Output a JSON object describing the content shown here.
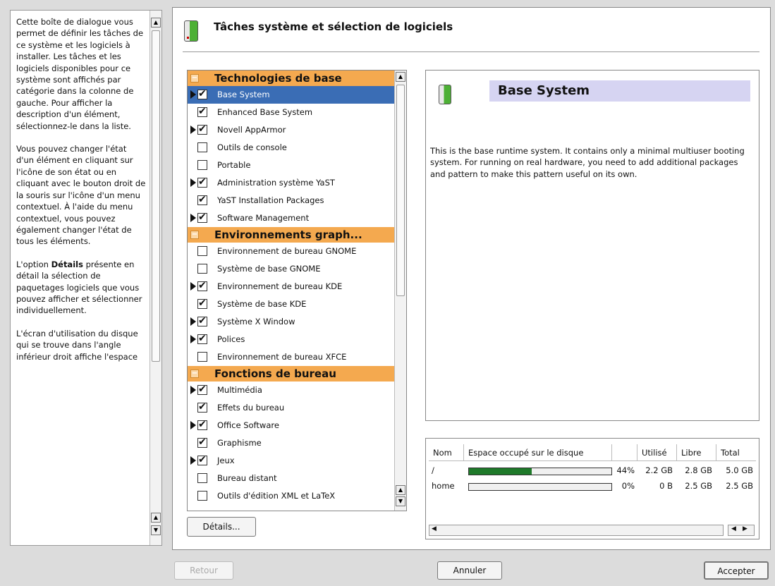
{
  "help": {
    "paragraphs": [
      "Cette boîte de dialogue vous permet de définir les tâches de ce système et les logiciels à installer. Les tâches et les logiciels disponibles pour ce système sont affichés par catégorie dans la colonne de gauche. Pour afficher la description d'un élément, sélectionnez-le dans la liste.",
      "Vous pouvez changer l'état d'un élément en cliquant sur l'icône de son état ou en cliquant avec le bouton droit de la souris sur l'icône d'un menu contextuel. À l'aide du menu contextuel, vous pouvez également changer l'état de tous les éléments."
    ],
    "details_prefix": "L'option ",
    "details_bold": "Détails",
    "details_suffix": " présente en détail la sélection de paquetages logiciels que vous pouvez afficher et sélectionner individuellement.",
    "last_paragraph": "L'écran d'utilisation du disque qui se trouve dans l'angle inférieur droit affiche l'espace"
  },
  "title": "Tâches système et sélection de logiciels",
  "patterns": {
    "categories": [
      {
        "label": "Technologies de base",
        "items": [
          {
            "label": "Base System",
            "checked": true,
            "arrow": true,
            "selected": true
          },
          {
            "label": "Enhanced Base System",
            "checked": true,
            "arrow": false
          },
          {
            "label": "Novell AppArmor",
            "checked": true,
            "arrow": true
          },
          {
            "label": "Outils de console",
            "checked": false,
            "arrow": false
          },
          {
            "label": "Portable",
            "checked": false,
            "arrow": false
          },
          {
            "label": "Administration système YaST",
            "checked": true,
            "arrow": true
          },
          {
            "label": "YaST Installation Packages",
            "checked": true,
            "arrow": false
          },
          {
            "label": "Software Management",
            "checked": true,
            "arrow": true
          }
        ]
      },
      {
        "label": "Environnements graph...",
        "items": [
          {
            "label": "Environnement de bureau GNOME",
            "checked": false,
            "arrow": false
          },
          {
            "label": "Système de base GNOME",
            "checked": false,
            "arrow": false
          },
          {
            "label": "Environnement de bureau KDE",
            "checked": true,
            "arrow": true
          },
          {
            "label": "Système de base KDE",
            "checked": true,
            "arrow": false
          },
          {
            "label": "Système X Window",
            "checked": true,
            "arrow": true
          },
          {
            "label": "Polices",
            "checked": true,
            "arrow": true
          },
          {
            "label": "Environnement de bureau XFCE",
            "checked": false,
            "arrow": false
          }
        ]
      },
      {
        "label": "Fonctions de bureau",
        "items": [
          {
            "label": "Multimédia",
            "checked": true,
            "arrow": true
          },
          {
            "label": "Effets du bureau",
            "checked": true,
            "arrow": false
          },
          {
            "label": "Office Software",
            "checked": true,
            "arrow": true
          },
          {
            "label": "Graphisme",
            "checked": true,
            "arrow": false
          },
          {
            "label": "Jeux",
            "checked": true,
            "arrow": true
          },
          {
            "label": "Bureau distant",
            "checked": false,
            "arrow": false
          },
          {
            "label": "Outils d'édition XML et LaTeX",
            "checked": false,
            "arrow": false
          }
        ]
      }
    ]
  },
  "details_button": "Détails...",
  "description": {
    "title": "Base System",
    "text": "This is the base runtime system. It contains only a minimal multiuser booting system. For running on real hardware, you need to add additional packages and pattern to make this pattern useful on its own."
  },
  "disk": {
    "headers": [
      "Nom",
      "Espace occupé sur le disque",
      "Utilisé",
      "Libre",
      "Total"
    ],
    "rows": [
      {
        "name": "/",
        "percent_label": "44%",
        "fraction": 0.44,
        "used": "2.2 GB",
        "free": "2.8 GB",
        "total": "5.0 GB"
      },
      {
        "name": "home",
        "percent_label": "0%",
        "fraction": 0.0,
        "used": "0 B",
        "free": "2.5 GB",
        "total": "2.5 GB"
      }
    ]
  },
  "buttons": {
    "back": "Retour",
    "cancel": "Annuler",
    "accept": "Accepter"
  },
  "colors": {
    "category_bg": "#f4a94f",
    "selection_bg": "#3a6db5",
    "title_bg": "#d6d4f2",
    "usage_bar": "#1f7a2a"
  }
}
